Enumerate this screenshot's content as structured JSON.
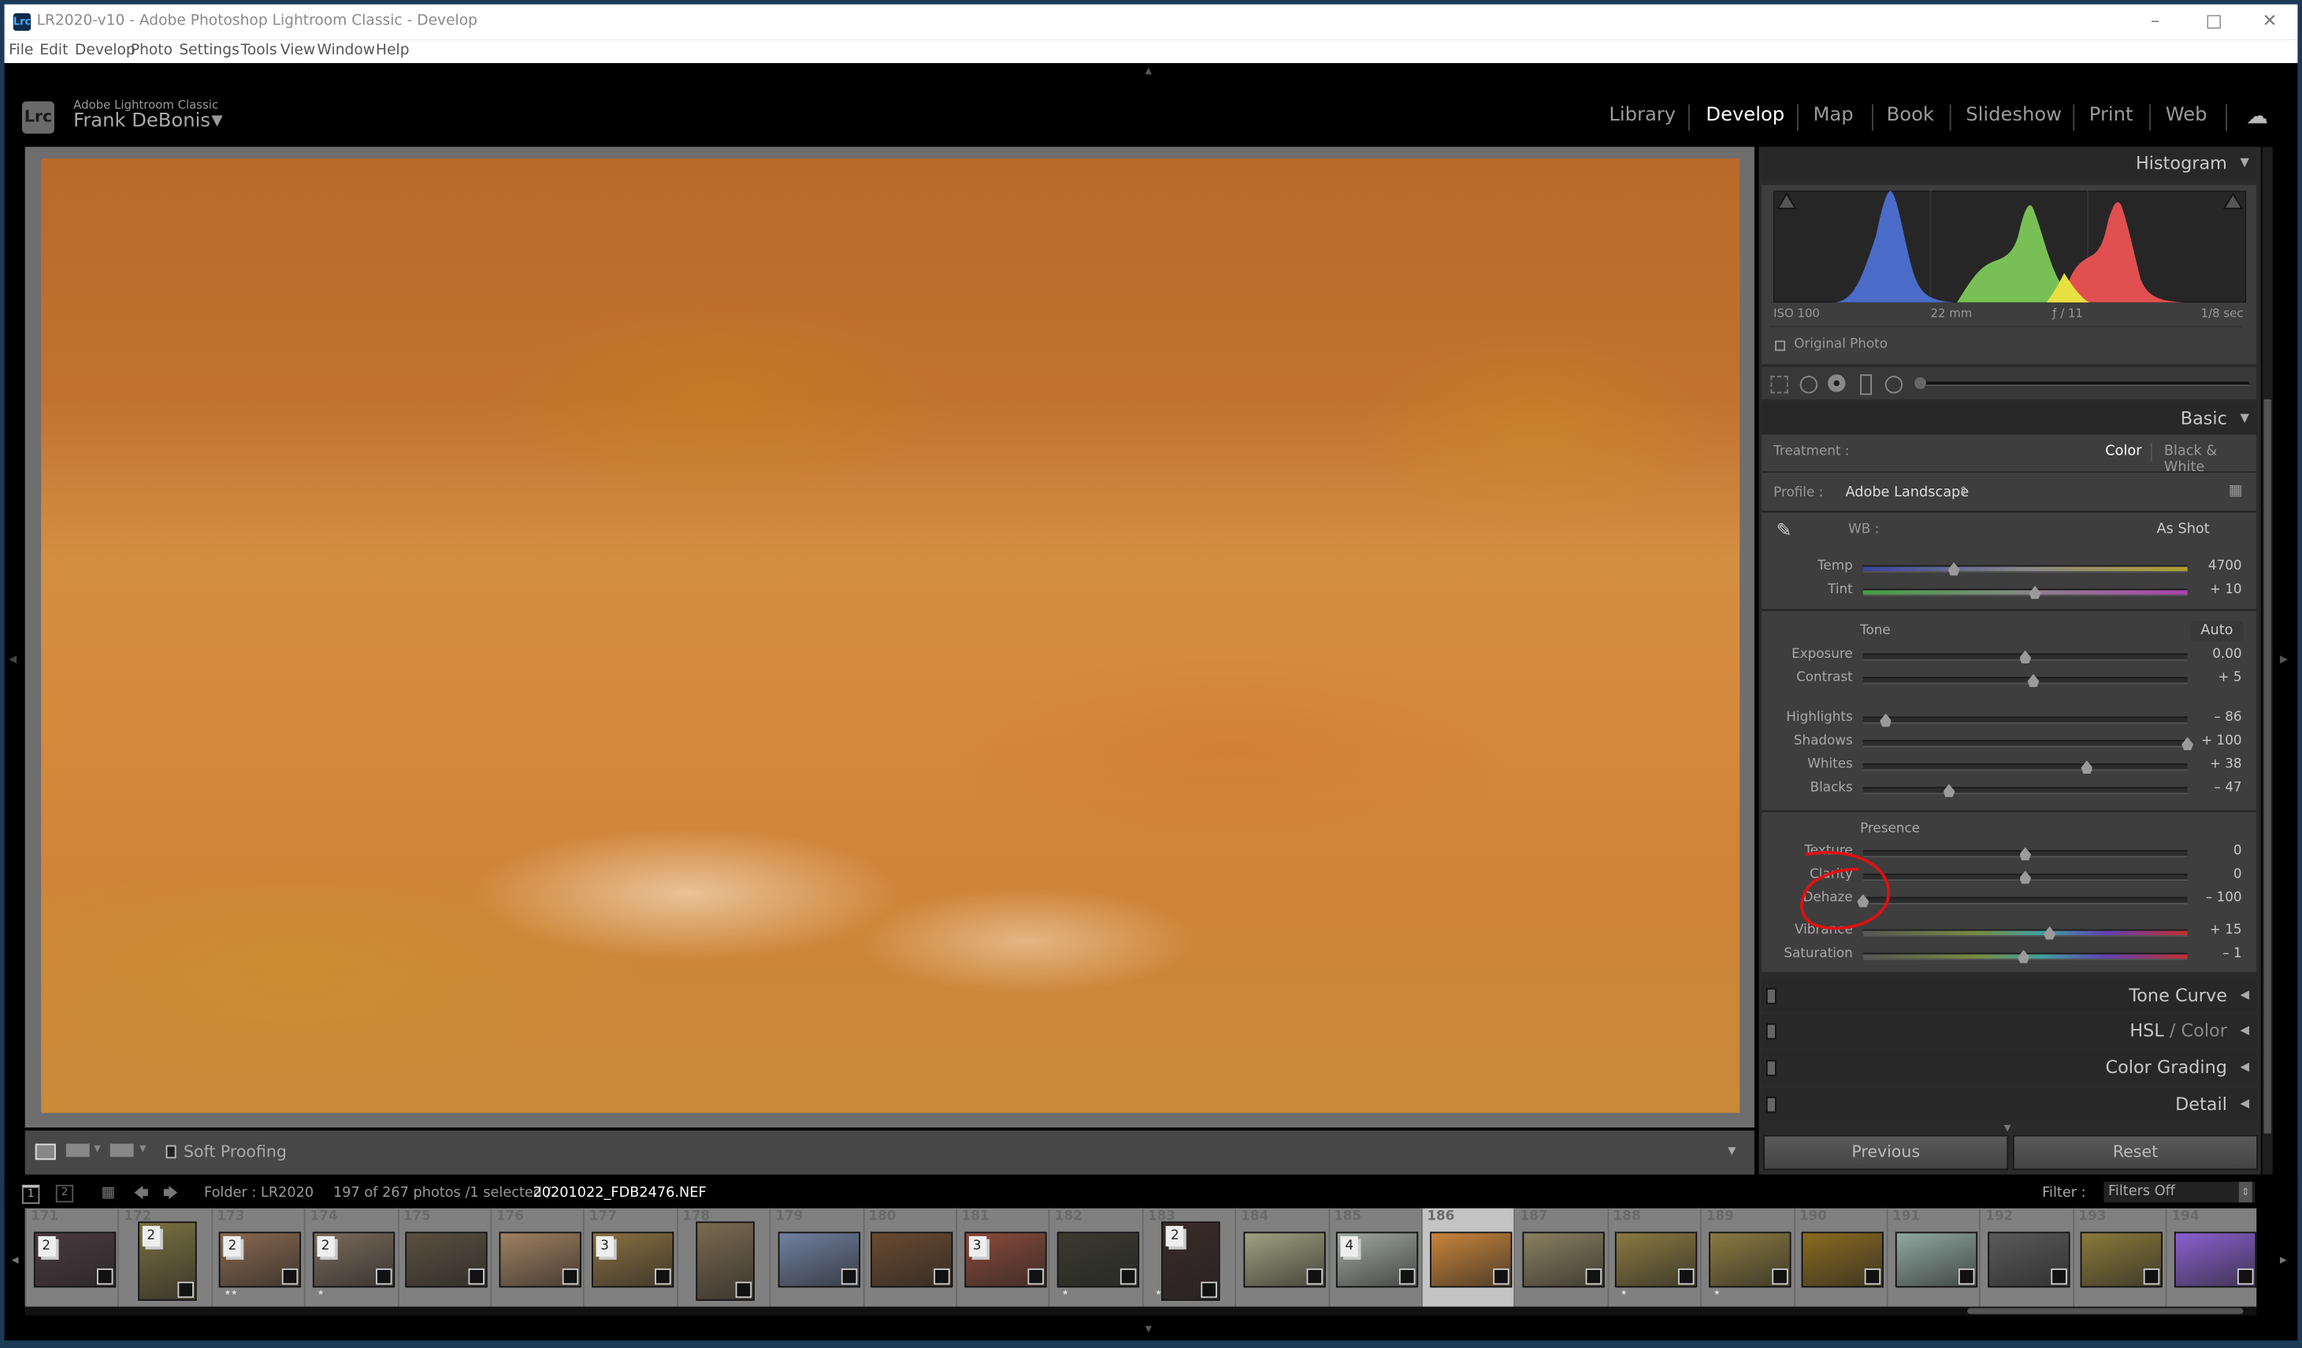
{
  "window": {
    "title": "LR2020-v10 - Adobe Photoshop Lightroom Classic - Develop",
    "app_icon": "Lrc",
    "controls": [
      "minimize-icon",
      "maximize-icon",
      "close-icon"
    ]
  },
  "menu": [
    "File",
    "Edit",
    "Develop",
    "Photo",
    "Settings",
    "Tools",
    "View",
    "Window",
    "Help"
  ],
  "identity": {
    "logo": "Lrc",
    "product": "Adobe Lightroom Classic",
    "user": "Frank DeBonis"
  },
  "modules": [
    {
      "label": "Library",
      "active": false
    },
    {
      "label": "Develop",
      "active": true
    },
    {
      "label": "Map",
      "active": false
    },
    {
      "label": "Book",
      "active": false
    },
    {
      "label": "Slideshow",
      "active": false
    },
    {
      "label": "Print",
      "active": false
    },
    {
      "label": "Web",
      "active": false
    }
  ],
  "toolbar": {
    "soft_proofing": "Soft Proofing"
  },
  "histogram": {
    "title": "Histogram",
    "iso": "ISO 100",
    "focal": "22 mm",
    "aperture": "ƒ / 11",
    "shutter": "1/8 sec",
    "original_photo": "Original Photo",
    "colors": {
      "blue": "#4a6cc8",
      "green": "#78c055",
      "red": "#e05050",
      "yellow": "#e8e040"
    }
  },
  "basic": {
    "title": "Basic",
    "treatment_label": "Treatment :",
    "treatment_color": "Color",
    "treatment_bw": "Black & White",
    "profile_label": "Profile :",
    "profile_value": "Adobe Landscape",
    "wb_label": "WB :",
    "wb_value": "As Shot",
    "tone_label": "Tone",
    "auto_label": "Auto",
    "presence_label": "Presence",
    "sliders": [
      {
        "label": "Temp",
        "value": "4700",
        "position": 0.28,
        "track": "temp"
      },
      {
        "label": "Tint",
        "value": "+ 10",
        "position": 0.53,
        "track": "tint"
      },
      {
        "label": "Exposure",
        "value": "0.00",
        "position": 0.5
      },
      {
        "label": "Contrast",
        "value": "+ 5",
        "position": 0.525
      },
      {
        "label": "Highlights",
        "value": "– 86",
        "position": 0.07
      },
      {
        "label": "Shadows",
        "value": "+ 100",
        "position": 1.0
      },
      {
        "label": "Whites",
        "value": "+ 38",
        "position": 0.69
      },
      {
        "label": "Blacks",
        "value": "– 47",
        "position": 0.265
      },
      {
        "label": "Texture",
        "value": "0",
        "position": 0.5
      },
      {
        "label": "Clarity",
        "value": "0",
        "position": 0.5
      },
      {
        "label": "Dehaze",
        "value": "– 100",
        "position": 0.0
      },
      {
        "label": "Vibrance",
        "value": "+ 15",
        "position": 0.575,
        "track": "color"
      },
      {
        "label": "Saturation",
        "value": "– 1",
        "position": 0.495,
        "track": "color"
      }
    ],
    "annotation_color": "#e01010"
  },
  "panels": [
    {
      "label": "Tone Curve"
    },
    {
      "label": "HSL",
      "label2": " / Color"
    },
    {
      "label": "Color Grading"
    },
    {
      "label": "Detail"
    }
  ],
  "buttons": {
    "previous": "Previous",
    "reset": "Reset"
  },
  "filmstrip": {
    "folder": "Folder : LR2020",
    "count": "197 of 267 photos /1 selected /",
    "filename": "20201022_FDB2476.NEF",
    "filter_label": "Filter :",
    "filter_value": "Filters Off",
    "page1": "1",
    "page2": "2",
    "items": [
      {
        "num": "171",
        "stack": "2",
        "color": "#4a3a40",
        "orientation": "landscape"
      },
      {
        "num": "172",
        "stack": "2",
        "color": "#7a7040",
        "orientation": "portrait"
      },
      {
        "num": "173",
        "stack": "2",
        "color": "#8a6a50",
        "orientation": "landscape",
        "stars": "★★"
      },
      {
        "num": "174",
        "stack": "2",
        "color": "#7a6a5a",
        "orientation": "landscape",
        "stars": "★"
      },
      {
        "num": "175",
        "stack": "",
        "color": "#5a5040",
        "orientation": "landscape"
      },
      {
        "num": "176",
        "stack": "",
        "color": "#a08060",
        "orientation": "landscape"
      },
      {
        "num": "177",
        "stack": "3",
        "color": "#8a7040",
        "orientation": "landscape"
      },
      {
        "num": "178",
        "stack": "",
        "color": "#7a6a50",
        "orientation": "portrait"
      },
      {
        "num": "179",
        "stack": "",
        "color": "#7080a0",
        "orientation": "landscape"
      },
      {
        "num": "180",
        "stack": "",
        "color": "#6a4a30",
        "orientation": "landscape"
      },
      {
        "num": "181",
        "stack": "3",
        "color": "#8a4a3a",
        "orientation": "landscape"
      },
      {
        "num": "182",
        "stack": "",
        "color": "#3a3a30",
        "orientation": "landscape",
        "stars": "★"
      },
      {
        "num": "183",
        "stack": "2",
        "color": "#3a2a28",
        "orientation": "portrait",
        "stars": "★"
      },
      {
        "num": "184",
        "stack": "",
        "color": "#a0a080",
        "orientation": "landscape"
      },
      {
        "num": "185",
        "stack": "4",
        "color": "#a0a8a0",
        "orientation": "landscape"
      },
      {
        "num": "186",
        "stack": "",
        "color": "#c8843a",
        "orientation": "landscape",
        "selected": true
      },
      {
        "num": "187",
        "stack": "",
        "color": "#8a8060",
        "orientation": "landscape"
      },
      {
        "num": "188",
        "stack": "",
        "color": "#8a7a40",
        "orientation": "landscape",
        "stars": "★"
      },
      {
        "num": "189",
        "stack": "",
        "color": "#8a7a40",
        "orientation": "landscape",
        "stars": "★"
      },
      {
        "num": "190",
        "stack": "",
        "color": "#8a6a20",
        "orientation": "landscape"
      },
      {
        "num": "191",
        "stack": "",
        "color": "#90a8a0",
        "orientation": "landscape"
      },
      {
        "num": "192",
        "stack": "",
        "color": "#5a5a5a",
        "orientation": "landscape"
      },
      {
        "num": "193",
        "stack": "",
        "color": "#8a7a3a",
        "orientation": "landscape"
      },
      {
        "num": "194",
        "stack": "",
        "color": "#8a60d0",
        "orientation": "landscape"
      }
    ]
  }
}
